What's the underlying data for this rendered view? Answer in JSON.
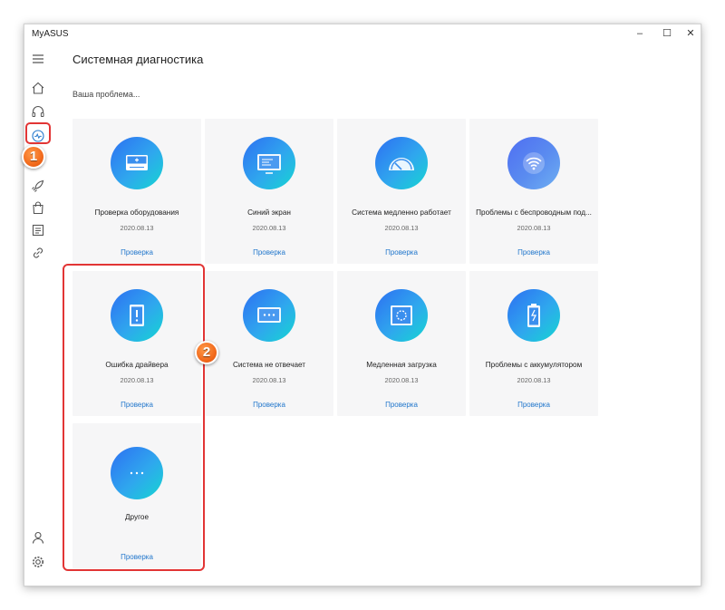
{
  "app": {
    "title": "MyASUS"
  },
  "window_controls": {
    "minimize": "–",
    "maximize": "☐",
    "close": "✕"
  },
  "header": {
    "title": "Системная диагностика",
    "subtitle": "Ваша проблема..."
  },
  "sidebar": {
    "items": [
      {
        "icon": "menu-icon"
      },
      {
        "icon": "home-icon"
      },
      {
        "icon": "headset-icon"
      },
      {
        "icon": "diagnostics-icon",
        "active": true
      },
      {
        "icon": "rocket-icon"
      },
      {
        "icon": "bag-icon"
      },
      {
        "icon": "news-icon"
      },
      {
        "icon": "link-icon"
      },
      {
        "icon": "user-icon"
      },
      {
        "icon": "gear-icon"
      }
    ]
  },
  "cards": [
    {
      "name": "Проверка оборудования",
      "date": "2020.08.13",
      "action": "Проверка",
      "icon": "hardware-icon"
    },
    {
      "name": "Синий экран",
      "date": "2020.08.13",
      "action": "Проверка",
      "icon": "blue-screen-icon"
    },
    {
      "name": "Система медленно работает",
      "date": "2020.08.13",
      "action": "Проверка",
      "icon": "speedometer-icon"
    },
    {
      "name": "Проблемы с беспроводным под...",
      "date": "2020.08.13",
      "action": "Проверка",
      "icon": "wifi-icon"
    },
    {
      "name": "Ошибка драйвера",
      "date": "2020.08.13",
      "action": "Проверка",
      "icon": "driver-error-icon"
    },
    {
      "name": "Система не отвечает",
      "date": "2020.08.13",
      "action": "Проверка",
      "icon": "not-responding-icon"
    },
    {
      "name": "Медленная загрузка",
      "date": "2020.08.13",
      "action": "Проверка",
      "icon": "slow-boot-icon"
    },
    {
      "name": "Проблемы с аккумулятором",
      "date": "2020.08.13",
      "action": "Проверка",
      "icon": "battery-icon"
    },
    {
      "name": "Другое",
      "date": "",
      "action": "Проверка",
      "icon": "more-icon"
    }
  ],
  "annotations": {
    "badge_1": "1",
    "badge_2": "2"
  },
  "colors": {
    "accent": "#2277cc",
    "highlight": "#e23535",
    "badge": "#f26b1d"
  }
}
